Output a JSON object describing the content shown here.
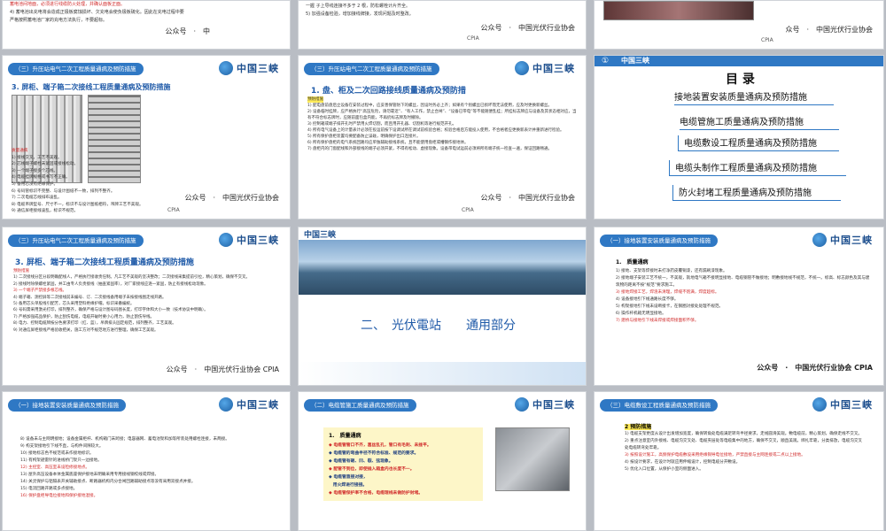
{
  "r0": {
    "a_lines": [
      "蓄电池间地面，必须进行线缆防火处理，并确认面板正面。",
      "4) 蓄电池出充电将会造成正极板腐蚀损坏、欠充电会使负极板硫化。因此在充电过程中要",
      "严格按照蓄电池厂家的充电方法执行，不要超标。"
    ],
    "a_footer": "公众号　·　中",
    "b_lines": [
      "一握 子上导线连接不多于 2 根，防松螺栓计片齐全。",
      "5) 加强设备检验，增加接线牌接，发现问题及时整改。"
    ],
    "b_footer": "公众号　·　中国光伏行业协会",
    "b_footer2": "CPIA",
    "c_footer": "众号　·　中国光伏行业协会",
    "c_footer2": "CPIA"
  },
  "s_r1c1": {
    "tag": "（三）升压站电气二次工程质量通病及预防措施",
    "logo": "中国三峡",
    "title": "3. 屏柜、端子箱二次接线工程质量通病及预防措施",
    "subhead": "质量通病",
    "lines": [
      "1) 接线交叉，工艺不美观。",
      "2) 芯线端子螺栓未紧固或接线松动。",
      "3) 一个端子接多个芯线。",
      "4) 电缆挂牌规格或书写不正确。",
      "5) 备用芯没有绝缘保护。",
      "6) 号码管标识不完整、与设计图纸不一致，排列不整齐。",
      "7) 二次电缆芯线排布凌乱。",
      "8) 电缆吊牌型号、尺寸不一，标识不与设计图纸相符，吊牌工艺不美观。",
      "9) 通信屏柜接线凌乱，标识不规范。"
    ],
    "footer": "公众号　·　中国光伏行业协会",
    "footer2": "CPIA"
  },
  "s_r1c2": {
    "tag": "（三）升压站电气二次工程质量通病及预防措施",
    "logo": "中国三峡",
    "title": "1. 盘、柜及二次回路接线质量通病及预防措",
    "subhead": "预防措施",
    "lines": [
      "1) 配电盘前盘后立设备在安装过程中，应妥善保管防下的螺丝，因设时务必上齐；如果有个别螺丝已损坏而无法使用，应及时更换新螺丝。",
      "2) 设备临时挂牌，应严格执行“高压危险，请勿靠近”、“有人工作，禁止合闸”、“设备已带电”等不能随便乱挂；所挂标志牌应与设备及其状态相对应，当有不符合标志牌时，应随前面包盒内能，不再扔标志牌及时撤除。",
      "3) 控制箱或端子排开孔时严禁用火焊切割，而且用开孔器、切割机等进行规范开孔。",
      "4) 所有电气设备上的计量表计必须在投运前按下设调试所在调试前校验合格；校验合格后方能投入使用，不合格者应更换新表计并重新进行检验。",
      "5) 所有保护盘柜装置均要配备防止误碰，明确保护出口连接片。",
      "6) 所有保护盘柜的电气系统回路均应单独辅助接线系统，且不能使用盘柜或槽钢作接地体。",
      "7) 盘柜内的门窗配线和外部接线的端子必须开紧，不得有松动、虚接现象。设备带电试运前必须将所有端子统一检查一遍，保证回路畅通。"
    ],
    "footer": "公众号　·　中国光伏行业协会",
    "footer2": "CPIA"
  },
  "s_r1c3": {
    "num": "①",
    "logo": "中国三峡",
    "toc_title": "目 录",
    "items": [
      "接地装置安装质量通病及预防措施",
      "电缆管施工质量通病及预防措施",
      "电缆敷设工程质量通病及预防措施",
      "电缆头制作工程质量通病及预防措施",
      "防火封堵工程质量通病及预防措施"
    ]
  },
  "s_r2c1": {
    "tag": "（三）升压站电气二次工程质量通病及预防措施",
    "logo": "中国三峡",
    "title": "3. 屏柜、端子箱二次接线工程质量通病及预防措施",
    "subhead": "预防措施",
    "lines": [
      "1) 二次接线分区分段明确配线人，严格执行接收责任制。凡工艺不美观的坚决整改；二次接线采集提前引拉，精心策划，确保不交叉。",
      "2) 接线时除保螺栓紧固，并工由专人负责接线（抽查紧固率），对厂家接线应逐一紧固，防止有接线松动现象。",
      "3) 一个端子严禁接多根芯线。",
      "4) 端子箱、测控屏等二次接线前未编号、订、二次接线备用端子未按接线图走线开路。",
      "5) 备用芯头单股线引配芳，芯头采用塑料绝缘护帽。标识采番编统。",
      "6) 号码需采用激光打印，排列整齐，确保严格与设计图号码图长度，打印字体和大小一致（技术协议中明确）。",
      "7) 严格加强成品保护，防止刮伤电缆，电缆开破时要小心用力，防止割伤导线。",
      "8) 电力、控制电缆牌按分色要求打印（红、蓝），吊牌排头固定规范，排列整齐，工艺美观。",
      "9) 对通信屏柜接线严格验收把关，施工方对不规范地方进行整理，确保工艺美观。"
    ],
    "footer": "公众号　·　中国光伏行业协会 CPIA"
  },
  "s_r2c2": {
    "logo": "中国三峡",
    "banner": "中國三峡",
    "part": "二、　光伏電站　　通用部分"
  },
  "s_r2c3": {
    "tag": "（一）接地装置安装质量通病及预防措施",
    "logo": "中国三峡",
    "head": "1.　质量通病",
    "lines": [
      "1) 接地、支架等焊接时未打净药皮覆铜漆，还有漏刷漆现象。",
      "2) 接地端子安装工艺不统一，不美观，就地电气箱不接明显接地、电缆钢管不做接地；明敷接地线不规范，不统一。标高、标志颜色及其与建筑物的距离不按“规范”要求施工。",
      "3) 接地焊接工艺，焊渣未清理，焊缝不饱满，焊度超标。",
      "4) 设备接地引下线通路长度不够。",
      "5) 构架接地引下线未设断接卡，在钢圈对接处处理不规范。",
      "6) 操作杆机箱无明显接地。",
      "7) 建桥与接地引下线未焊接或焊接面积不够。"
    ],
    "footer": "公众号　·　中国光伏行业协会 CPIA"
  },
  "s_r3c1": {
    "tag": "（一）接地装置安装质量通病及预防措施",
    "logo": "中国三峡",
    "lines": [
      "8) 设备未与主网明接地；设备金属柜杆、机构箱门未跨接；电容器网、蓄电池架和加等所装处用螺栓连接，未两接。",
      "9) 构支架接地引下线不直，与构件间隙较大。",
      "10) 接地标志色不规范或未作接地标识。",
      "11) 有构架避雷针的进线桥门架只一边接地。",
      "12) 主控室、高压室未设检修接地点。",
      "13) 屋外高压设备本体金属底座保护接地未明确采用专用接线钢绞线或焊接。",
      "14) 关灵保护与铝隔表开关辅助接点、断路器机构内分合闸回路辅助接点等没有采用双接点并接。",
      "15) 电流回路开路或多点接地。",
      "16) 保护盘柜导电位接地和保护接地混接。"
    ]
  },
  "s_r3c2": {
    "tag": "（二）电缆管施工质量通病及预防措施",
    "logo": "中国三峡",
    "head": "1.　质量通病",
    "lines": [
      "◆ 电缆管管口不齐，喜丝乱孔，管口有毛刺、未挫平。",
      "◆ 电缆管的弯曲半径不符合标准、规范的要求。",
      "◆ 电缆管有砸、凹、裂、弦现象。",
      "◆ 配管不到位，即使插入箱盒内也长度不一。",
      "◆ 电缆管直接对接，",
      "　用火焊进行接接。",
      "◆ 电缆管保护率不合格，电缆理线未做防护封堵。"
    ]
  },
  "s_r3c3": {
    "tag": "（三）电缆敷设工程质量通病及预防措施",
    "logo": "中国三峡",
    "head": "2 预防措施",
    "lines": [
      "1) 电缆支架更度从设计出发增加宽度，确保转角处电缆满足转弯半径要求，走线圆滑美观。敷电缆前，精心策划，确保走线不交叉。",
      "2) 重点注意室内外接线、电缆沟交叉处、电缆夹层处等电缆集中的地方，确保不交叉，顺直美观。绑扎牢靠，分类排放，电缆沟交叉处电缆转弯处牢靠。",
      "3) 按照设计施工，高频保护电缆敷设采用绝缘铜导电位接地，严禁直接与主网连接或二点以上接地。",
      "4) 按设计要求，在设计时就应用伸缩设计，控制电缆分开敷设。",
      "5) 优化入口位置，从保护小室的侧面进入。"
    ]
  }
}
